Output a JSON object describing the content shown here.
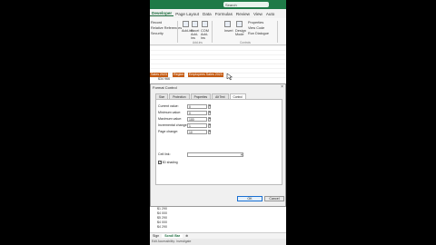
{
  "titlebar": {
    "search": "Search"
  },
  "ribbon_tabs": [
    "Developer",
    "Page Layout",
    "Data",
    "Formulas",
    "Review",
    "View",
    "Auto"
  ],
  "active_tab": "Developer",
  "ribbon": {
    "left_items": [
      "Record",
      "Relative References",
      "Security"
    ],
    "addins": {
      "addins_label": "Add-ins",
      "excel_addins_label": "Excel Add-ins",
      "com_addins_label": "COM Add-ins",
      "group_label": "Add-ins"
    },
    "controls": {
      "insert_label": "Insert",
      "design_mode_label": "Design Mode",
      "properties_label": "Properties",
      "view_code_label": "View Code",
      "run_dialog_label": "Run Dialogue",
      "group_label": "Controls"
    }
  },
  "sheet": {
    "tag1": "Sales 2023",
    "tag2": "Region",
    "tag3": "Employees Sales 2023",
    "cell_value": "$34 966"
  },
  "dialog": {
    "title": "Format Control",
    "close": "×",
    "tabs": [
      "Size",
      "Protection",
      "Properties",
      "Alt Text",
      "Control"
    ],
    "active_tab": "Control",
    "fields": [
      {
        "label": "Current value:",
        "value": "0"
      },
      {
        "label": "Minimum value:",
        "value": "0"
      },
      {
        "label": "Maximum value:",
        "value": "100"
      },
      {
        "label": "Incremental change:",
        "value": "1"
      },
      {
        "label": "Page change:",
        "value": "10"
      }
    ],
    "cell_link_label": "Cell link:",
    "cell_link_value": "",
    "shading_label": "3D shading",
    "shading_checked": true,
    "ok_label": "OK",
    "cancel_label": "Cancel"
  },
  "column_values": [
    "$1 290",
    "$4 000",
    "$5 290",
    "$4 000",
    "$4 290"
  ],
  "sheet_tabs": [
    "Sign",
    "Scroll Bar"
  ],
  "active_sheet": "Scroll Bar",
  "status": "Edit  Accessibility: Investigate"
}
